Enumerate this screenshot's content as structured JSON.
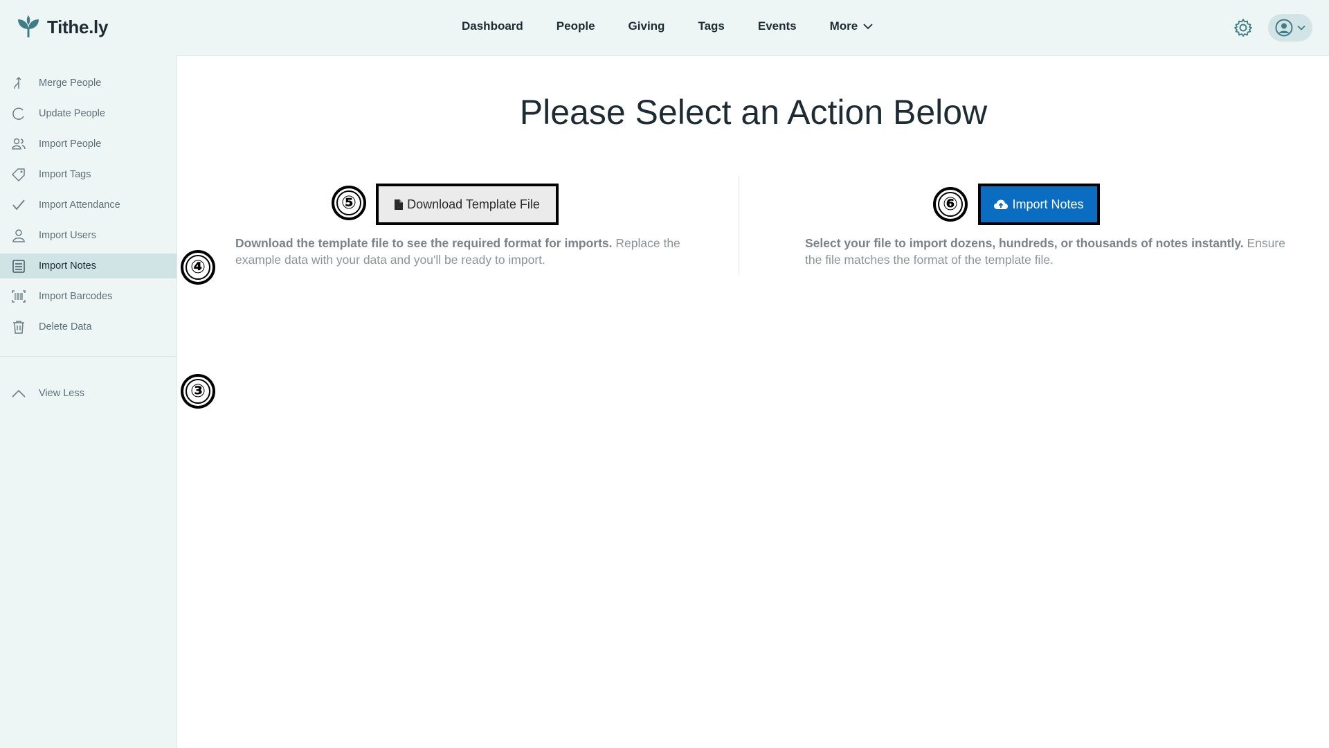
{
  "app": {
    "name": "Tithe.ly"
  },
  "nav": {
    "items": [
      {
        "label": "Dashboard"
      },
      {
        "label": "People"
      },
      {
        "label": "Giving"
      },
      {
        "label": "Tags"
      },
      {
        "label": "Events"
      }
    ],
    "more_label": "More"
  },
  "sidebar": {
    "items": [
      {
        "label": "Merge People",
        "icon": "merge-icon"
      },
      {
        "label": "Update People",
        "icon": "refresh-icon"
      },
      {
        "label": "Import People",
        "icon": "people-icon"
      },
      {
        "label": "Import Tags",
        "icon": "tag-icon"
      },
      {
        "label": "Import Attendance",
        "icon": "check-icon"
      },
      {
        "label": "Import Users",
        "icon": "user-icon"
      },
      {
        "label": "Import Notes",
        "icon": "notes-icon",
        "active": true
      },
      {
        "label": "Import Barcodes",
        "icon": "barcode-icon"
      },
      {
        "label": "Delete Data",
        "icon": "trash-icon"
      }
    ],
    "view_less_label": "View Less"
  },
  "main": {
    "title": "Please Select an Action Below",
    "download": {
      "button_label": "Download Template File",
      "desc_bold": "Download the template file to see the required format for imports.",
      "desc_rest": " Replace the example data with your data and you'll be ready to import."
    },
    "import": {
      "button_label": "Import Notes",
      "desc_bold": "Select your file to import dozens, hundreds, or thousands of notes instantly.",
      "desc_rest": " Ensure the file matches the format of the template file."
    }
  },
  "annotations": {
    "three": "③",
    "four": "④",
    "five": "⑤",
    "six": "⑥"
  },
  "colors": {
    "brand": "#3f7e86",
    "primary_button": "#0a6dc2",
    "sidebar_bg": "#eef5f5",
    "active_item_bg": "#d0e3e5"
  }
}
